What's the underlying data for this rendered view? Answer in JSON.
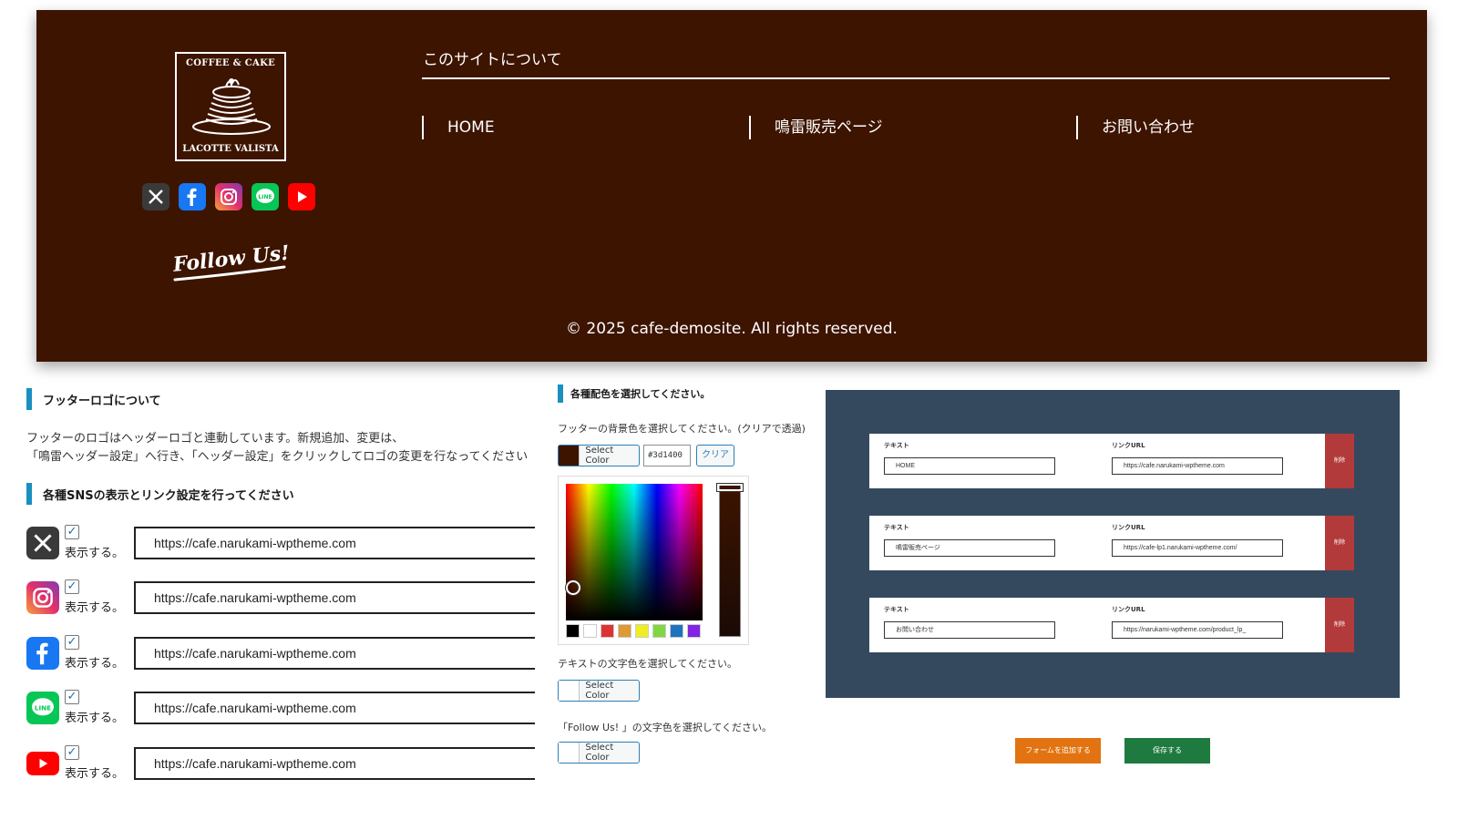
{
  "footer_preview": {
    "logo": {
      "top": "COFFEE & CAKE",
      "bottom": "LACOTTE VALISTA"
    },
    "sns_icons": [
      "x-icon",
      "facebook-icon",
      "instagram-icon",
      "line-icon",
      "youtube-icon"
    ],
    "follow_us": "Follow Us!",
    "about_title": "このサイトについて",
    "nav_items": [
      {
        "label": "HOME"
      },
      {
        "label": "鳴雷販売ページ"
      },
      {
        "label": "お問い合わせ"
      }
    ],
    "copyright": "© 2025 cafe-demosite. All rights reserved.",
    "bg_color": "#3d1400"
  },
  "logo_section": {
    "title": "フッターロゴについて",
    "desc_line1": "フッターのロゴはヘッダーロゴと連動しています。新規追加、変更は、",
    "desc_line2": "「鳴雷ヘッダー設定」へ行き、「ヘッダー設定」をクリックしてロゴの変更を行なってください"
  },
  "sns_section": {
    "title": "各種SNSの表示とリンク設定を行ってください",
    "items": [
      {
        "icon": "x-icon",
        "checked": "✓",
        "label": "表示する。",
        "url": "https://cafe.narukami-wptheme.com"
      },
      {
        "icon": "instagram-icon",
        "checked": "✓",
        "label": "表示する。",
        "url": "https://cafe.narukami-wptheme.com"
      },
      {
        "icon": "facebook-icon",
        "checked": "✓",
        "label": "表示する。",
        "url": "https://cafe.narukami-wptheme.com"
      },
      {
        "icon": "line-icon",
        "checked": "✓",
        "label": "表示する。",
        "url": "https://cafe.narukami-wptheme.com"
      },
      {
        "icon": "youtube-icon",
        "checked": "✓",
        "label": "表示する。",
        "url": "https://cafe.narukami-wptheme.com"
      }
    ]
  },
  "color_section": {
    "title": "各種配色を選択してください。",
    "bg_label": "フッターの背景色を選択してください。(クリアで透過)",
    "select_color": "Select Color",
    "hex_value": "#3d1400",
    "clear": "クリア",
    "text_label": "テキストの文字色を選択してください。",
    "follow_label": "「Follow Us! 」の文字色を選択してください。",
    "palette": [
      "#000000",
      "#ffffff",
      "#dd3333",
      "#dd9933",
      "#eeee22",
      "#81d742",
      "#1e73be",
      "#8224e3"
    ]
  },
  "nav_form": {
    "bg_color": "#34495e",
    "text_label": "テキスト",
    "url_label": "リンクURL",
    "delete": "削除",
    "rows": [
      {
        "text": "HOME",
        "url": "https://cafe.narukami-wptheme.com"
      },
      {
        "text": "鳴雷販売ページ",
        "url": "https://cafe-lp1.narukami-wptheme.com/"
      },
      {
        "text": "お問い合わせ",
        "url": "https://narukami-wptheme.com/product_lp_"
      }
    ],
    "add_button": "フォームを追加する",
    "save_button": "保存する"
  }
}
